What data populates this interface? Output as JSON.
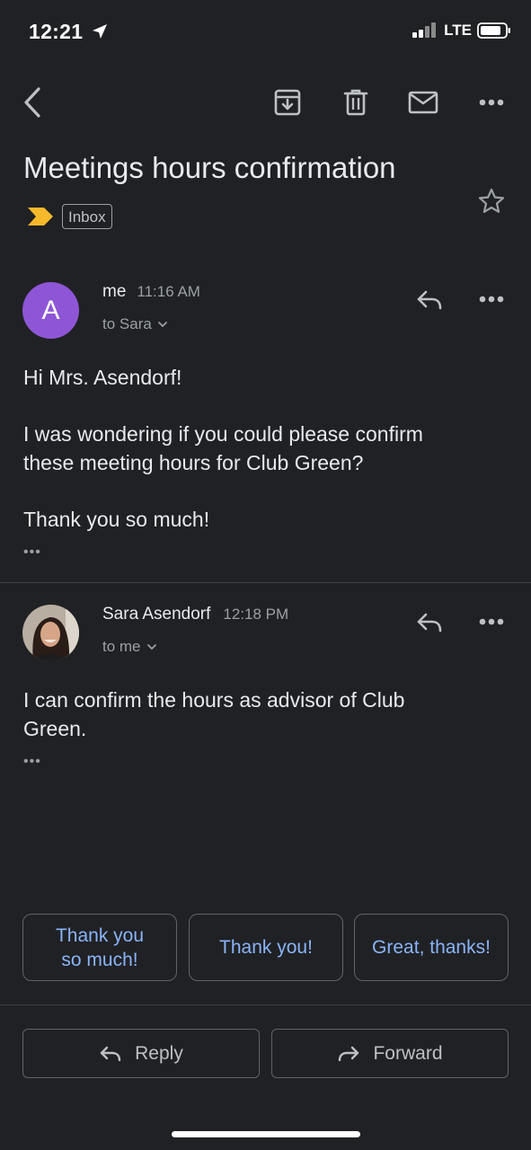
{
  "status_bar": {
    "time": "12:21",
    "network": "LTE"
  },
  "toolbar": {
    "icons": [
      "back-icon",
      "archive-icon",
      "trash-icon",
      "mail-icon",
      "more-icon"
    ]
  },
  "email": {
    "subject": "Meetings hours confirmation",
    "label": "Inbox",
    "importance_color": "#f6b92b"
  },
  "messages": [
    {
      "avatar_letter": "A",
      "avatar_color": "#8e56d6",
      "sender": "me",
      "time": "11:16 AM",
      "recipients": "to Sara",
      "body": [
        "Hi Mrs. Asendorf!",
        "I was wondering if you could please confirm",
        "these meeting hours for Club Green?",
        "Thank you so much!"
      ],
      "trimmed": "•••"
    },
    {
      "sender": "Sara Asendorf",
      "time": "12:18 PM",
      "recipients": "to me",
      "body": [
        "I can confirm the hours as advisor of Club",
        "Green."
      ],
      "trimmed": "•••"
    }
  ],
  "smart_replies": [
    {
      "line1": "Thank you",
      "line2": "so much!"
    },
    {
      "line1": "Thank you!"
    },
    {
      "line1": "Great, thanks!"
    }
  ],
  "actions": {
    "reply": "Reply",
    "forward": "Forward"
  }
}
